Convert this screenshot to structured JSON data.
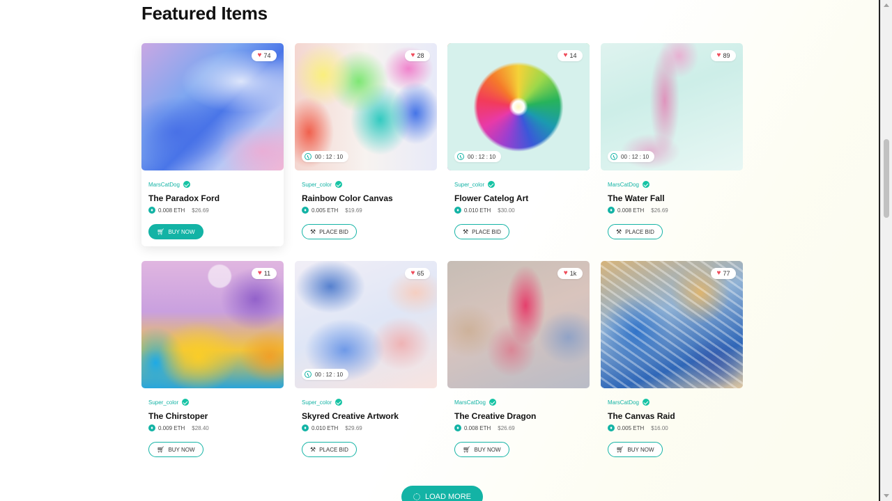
{
  "section": {
    "title": "Featured Items"
  },
  "items": [
    {
      "likes": "74",
      "timer": "",
      "owner": "MarsCatDog",
      "name": "The Paradox Ford",
      "eth": "0.008 ETH",
      "usd": "$26.69",
      "action": "BUY NOW",
      "action_icon": "cart-icon",
      "style": "primary"
    },
    {
      "likes": "28",
      "timer": "00 : 12 : 10",
      "owner": "Super_color",
      "name": "Rainbow Color Canvas",
      "eth": "0.005 ETH",
      "usd": "$19.69",
      "action": "PLACE BID",
      "action_icon": "gavel-icon",
      "style": "outline"
    },
    {
      "likes": "14",
      "timer": "00 : 12 : 10",
      "owner": "Super_color",
      "name": "Flower Catelog Art",
      "eth": "0.010 ETH",
      "usd": "$30.00",
      "action": "PLACE BID",
      "action_icon": "gavel-icon",
      "style": "outline"
    },
    {
      "likes": "89",
      "timer": "00 : 12 : 10",
      "owner": "MarsCatDog",
      "name": "The Water Fall",
      "eth": "0.008 ETH",
      "usd": "$26.69",
      "action": "PLACE BID",
      "action_icon": "gavel-icon",
      "style": "outline"
    },
    {
      "likes": "11",
      "timer": "",
      "owner": "Super_color",
      "name": "The Chirstoper",
      "eth": "0.009 ETH",
      "usd": "$28.40",
      "action": "BUY NOW",
      "action_icon": "cart-icon",
      "style": "outline"
    },
    {
      "likes": "65",
      "timer": "00 : 12 : 10",
      "owner": "Super_color",
      "name": "Skyred Creative Artwork",
      "eth": "0.010 ETH",
      "usd": "$29.69",
      "action": "PLACE BID",
      "action_icon": "gavel-icon",
      "style": "outline"
    },
    {
      "likes": "1k",
      "timer": "",
      "owner": "MarsCatDog",
      "name": "The Creative Dragon",
      "eth": "0.008 ETH",
      "usd": "$26.69",
      "action": "BUY NOW",
      "action_icon": "cart-icon",
      "style": "outline"
    },
    {
      "likes": "77",
      "timer": "",
      "owner": "MarsCatDog",
      "name": "The Canvas Raid",
      "eth": "0.005 ETH",
      "usd": "$16.00",
      "action": "BUY NOW",
      "action_icon": "cart-icon",
      "style": "outline"
    }
  ],
  "load_more": {
    "label": "LOAD MORE"
  },
  "colors": {
    "accent": "#13b3a5",
    "heart": "#ef4b5a"
  }
}
